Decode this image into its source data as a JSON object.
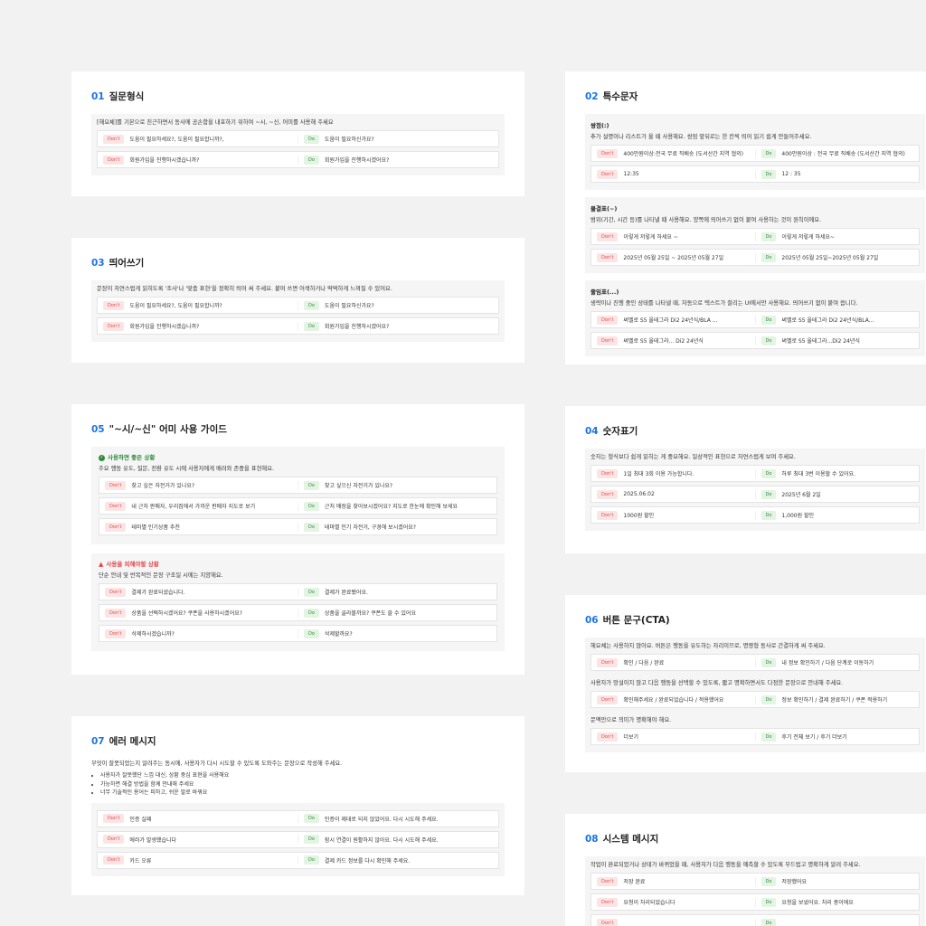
{
  "labels": {
    "dont": "Don't",
    "do": "Do"
  },
  "colors": {
    "accent": "#1a73e8",
    "dont": "#e04848",
    "do": "#2e8b3c"
  },
  "s01": {
    "num": "01",
    "title": "질문형식",
    "desc": "[해요체]를 기본으로 친근하면서 동사에 공손함을 내포하기 위하여 ~시, ~신, 어미를 사용해 주세요",
    "rows": [
      {
        "dont": "도움이 필요하세요?,  도움이 필요합니까?,",
        "do": "도움이 필요하신가요?"
      },
      {
        "dont": "회원가입을 진행하시겠습니까?",
        "do": "회원가입을 진행하시겠어요?"
      }
    ]
  },
  "s03": {
    "num": "03",
    "title": "띄어쓰기",
    "desc": "문장이 자연스럽게 읽히도록 '조사'나 '맞춤 표현'을 정확히 띄어 써 주세요. 붙여 쓰면 어색하거나 딱딱하게 느껴질 수 있어요.",
    "rows": [
      {
        "dont": "도움이 필요하세요?, 도움이 필요합니까?",
        "do": "도움이 필요하신가요?"
      },
      {
        "dont": "회원가입을 진행하시겠습니까?",
        "do": "회원가입을 진행하시겠어요?"
      }
    ]
  },
  "s05": {
    "num": "05",
    "title": "\"~시/~신\" 어미 사용 가이드",
    "good": {
      "head": "사용하면 좋은 상황",
      "desc": "주요 행동 유도, 질문, 전환 유도 시에 사용자에게 배려와 존중을 표현해요.",
      "rows": [
        {
          "dont": "찾고 싶은 자전거가 있나요?",
          "do": "찾고 싶으신 자전거가 있나요?"
        },
        {
          "dont": "내 근처 판매자, 우리집에서 가까운 판매자 지도로 보기",
          "do": "근처 매장을 찾아보시겠어요? 지도로 한눈에 확인해 보세요"
        },
        {
          "dont": "테마별 인기상품 추천",
          "do": "테마별 인기 자전거, 구경해 보시겠어요?"
        }
      ]
    },
    "bad": {
      "head": "사용을 피해야할 상황",
      "desc": "단순 안내 및 반복적인 문장 구조일 시에는 지양해요.",
      "rows": [
        {
          "dont": "결제가 완료되셨습니다.",
          "do": "결제가 완료됐어요."
        },
        {
          "dont": "상품을 선택하시겠어요? 쿠폰을 사용하시겠어요?",
          "do": "상품을 골라볼까요? 쿠폰도 쓸 수 있어요"
        },
        {
          "dont": "삭제하시겠습니까?",
          "do": "삭제할까요?"
        }
      ]
    }
  },
  "s07": {
    "num": "07",
    "title": "에러 메시지",
    "desc": "무엇이 잘못되었는지 알려주는 동시에, 사용자가 다시 시도할 수 있도록 도와주는 문장으로 작성해 주세요.",
    "bullets": [
      "사용자가 잘못했단 느낌 대신, 상황 중심 표현을 사용해요",
      "가능하면 해결 방법을 함께 안내해 주세요",
      "너무 기술적인 용어는 피하고, 쉬운 말로 바꿔요"
    ],
    "rows": [
      {
        "dont": "인증 실패",
        "do": "인증이 제대로 되지 않았어요. 다시 시도해 주세요."
      },
      {
        "dont": "에러가 발생했습니다",
        "do": "잠시 연결이 원활하지 않아요. 다시 시도해 주세요."
      },
      {
        "dont": "카드 오류",
        "do": "결제 카드 정보를 다시 확인해 주세요."
      }
    ]
  },
  "s02": {
    "num": "02",
    "title": "특수문자",
    "groups": [
      {
        "label": "쌍점(:)",
        "desc": "추가 설명이나 리스트가 올 때 사용해요. 쌍점 앞뒤로는 한 칸씩 띄어 읽기 쉽게 만들어주세요.",
        "rows": [
          {
            "dont": "400만원이상:전국 무료 직배송 (도서산간 지역 협의)",
            "do": "400만원이상 : 전국 무료 직배송 (도서산간 지역 협의)"
          },
          {
            "dont": "12:35",
            "do": "12 : 35"
          }
        ]
      },
      {
        "label": "물결표(~)",
        "desc": "범위(기간, 시간 등)를 나타낼 때 사용해요. 양쪽에 띄어쓰기 없이 붙여 사용하는 것이 원칙이에요.",
        "rows": [
          {
            "dont": "이렇게 저렇게 하세요 ~",
            "do": "이렇게 저렇게 하세요~"
          },
          {
            "dont": "2025년 05월 25일 ~ 2025년 05월 27일",
            "do": "2025년 05월 25일~2025년 05월 27일"
          }
        ]
      },
      {
        "label": "줄임표(...)",
        "desc": "생략이나 진행 중인 상태를 나타낼 때, 자동으로 텍스트가 잘리는 UI에서만 사용해요. 띄어쓰기 없이 붙여 씁니다.",
        "rows": [
          {
            "dont": "써벨로 S5 울테그라 Di2 24년식/BLA ...",
            "do": "써벨로 S5 울테그라 Di2 24년식/BLA..."
          },
          {
            "dont": "써벨로 S5 울테그라... Di2 24년식",
            "do": "써벨로 S5 울테그라...Di2 24년식"
          }
        ]
      }
    ]
  },
  "s04": {
    "num": "04",
    "title": "숫자표기",
    "desc": "숫자는 형식보다 쉽게 읽히는 게 중요해요. 일상적인 표현으로 자연스럽게 보여 주세요.",
    "rows": [
      {
        "dont": "1일 최대 3회 이용 가능합니다.",
        "do": "하루 최대 3번 이용할 수 있어요."
      },
      {
        "dont": "2025.06.02",
        "do": "2025년 6월 2일"
      },
      {
        "dont": "1000원 할인",
        "do": "1,000원 할인"
      }
    ]
  },
  "s06": {
    "num": "06",
    "title": "버튼 문구(CTA)",
    "parts": [
      {
        "desc": "해요체는 사용하지 않아요. 버튼은 행동을 유도하는 자리이므로, 명령형 동사로 간결하게 써 주세요.",
        "rows": [
          {
            "dont": "확인 / 다음 / 완료",
            "do": "내 정보 확인하기 / 다음 단계로 이동하기"
          }
        ]
      },
      {
        "desc": "사용자가 망설이지 않고 다음 행동을 선택할 수 있도록, 짧고 명확하면서도 다정한 문장으로 안내해 주세요.",
        "rows": [
          {
            "dont": "확인해주세요 / 완료되었습니다 / 적용했어요",
            "do": "정보 확인하기 / 결제 완료하기 / 쿠폰 적용하기"
          }
        ]
      },
      {
        "desc": "문맥만으로 의미가 명확해야 해요.",
        "rows": [
          {
            "dont": "더보기",
            "do": "후기 전체 보기 / 후기 더보기"
          }
        ]
      }
    ]
  },
  "s08": {
    "num": "08",
    "title": "시스템 메시지",
    "desc": "작업이 완료되었거나 상태가 바뀌었을 때, 사용자가 다음 행동을 예측할 수 있도록 부드럽고 명확하게 알려 주세요.",
    "rows": [
      {
        "dont": "저장 완료",
        "do": "저장했어요"
      },
      {
        "dont": "요청이 처리되었습니다",
        "do": "요청을 보냈어요. 처리 중이에요"
      },
      {
        "dont": "",
        "do": ""
      }
    ]
  }
}
